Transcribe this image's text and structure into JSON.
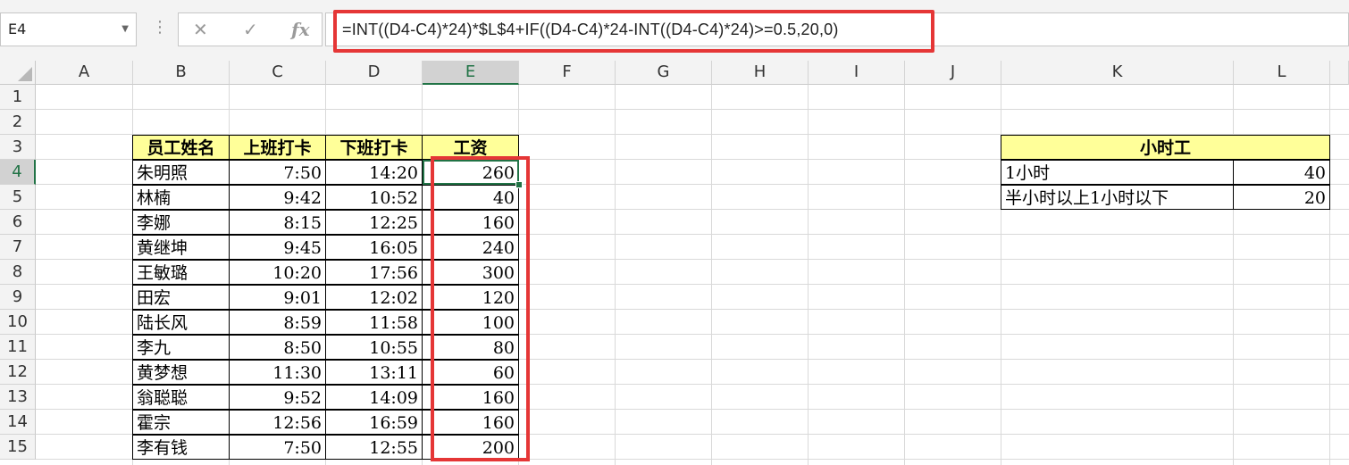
{
  "namebox": "E4",
  "formula": "=INT((D4-C4)*24)*$L$4+IF((D4-C4)*24-INT((D4-C4)*24)>=0.5,20,0)",
  "fx_label": "fx",
  "cancel_label": "✕",
  "enter_label": "✓",
  "columns": [
    "A",
    "B",
    "C",
    "D",
    "E",
    "F",
    "G",
    "H",
    "I",
    "J",
    "K",
    "L"
  ],
  "rows": [
    "1",
    "2",
    "3",
    "4",
    "5",
    "6",
    "7",
    "8",
    "9",
    "10",
    "11",
    "12",
    "13",
    "14",
    "15"
  ],
  "table": {
    "headers": [
      "员工姓名",
      "上班打卡",
      "下班打卡",
      "工资"
    ],
    "data": [
      [
        "朱明照",
        "7:50",
        "14:20",
        "260"
      ],
      [
        "林楠",
        "9:42",
        "10:52",
        "40"
      ],
      [
        "李娜",
        "8:15",
        "12:25",
        "160"
      ],
      [
        "黄继坤",
        "9:45",
        "16:05",
        "240"
      ],
      [
        "王敏璐",
        "10:20",
        "17:56",
        "300"
      ],
      [
        "田宏",
        "9:01",
        "12:02",
        "120"
      ],
      [
        "陆长风",
        "8:59",
        "11:58",
        "100"
      ],
      [
        "李九",
        "8:50",
        "10:55",
        "80"
      ],
      [
        "黄梦想",
        "11:30",
        "13:11",
        "60"
      ],
      [
        "翁聪聪",
        "9:52",
        "14:09",
        "160"
      ],
      [
        "霍宗",
        "12:56",
        "16:59",
        "160"
      ],
      [
        "李有钱",
        "7:50",
        "12:55",
        "200"
      ]
    ]
  },
  "rate_table": {
    "title": "小时工",
    "rows": [
      [
        "1小时",
        "40"
      ],
      [
        "半小时以上1小时以下",
        "20"
      ]
    ]
  }
}
